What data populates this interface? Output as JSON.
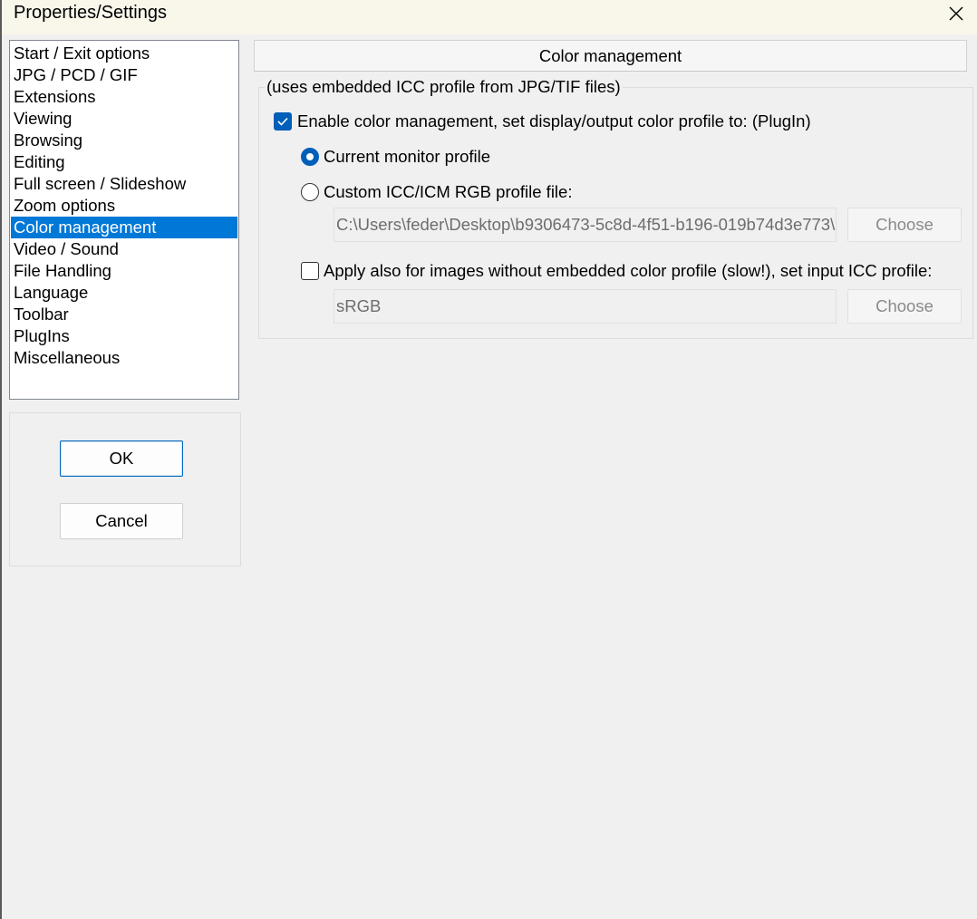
{
  "window": {
    "title": "Properties/Settings",
    "close_icon": "close-icon"
  },
  "sidebar": {
    "items": [
      {
        "label": "Start / Exit options",
        "selected": false
      },
      {
        "label": "JPG / PCD / GIF",
        "selected": false
      },
      {
        "label": "Extensions",
        "selected": false
      },
      {
        "label": "Viewing",
        "selected": false
      },
      {
        "label": "Browsing",
        "selected": false
      },
      {
        "label": "Editing",
        "selected": false
      },
      {
        "label": "Full screen / Slideshow",
        "selected": false
      },
      {
        "label": "Zoom options",
        "selected": false
      },
      {
        "label": "Color management",
        "selected": true
      },
      {
        "label": "Video / Sound",
        "selected": false
      },
      {
        "label": "File Handling",
        "selected": false
      },
      {
        "label": "Language",
        "selected": false
      },
      {
        "label": "Toolbar",
        "selected": false
      },
      {
        "label": "PlugIns",
        "selected": false
      },
      {
        "label": "Miscellaneous",
        "selected": false
      }
    ],
    "selection_color": "#0078d7"
  },
  "buttons": {
    "ok_label": "OK",
    "cancel_label": "Cancel"
  },
  "panel": {
    "header": "Color management",
    "group_legend": "(uses embedded ICC profile from JPG/TIF files)",
    "enable_cm": {
      "label": "Enable color management, set display/output color profile to: (PlugIn)",
      "checked": true
    },
    "current_monitor": {
      "label": "Current monitor profile",
      "selected": true
    },
    "custom_icc": {
      "label": "Custom ICC/ICM RGB profile file:",
      "selected": false,
      "path_value": "C:\\Users\\feder\\Desktop\\b9306473-5c8d-4f51-b196-019b74d3e773\\",
      "choose_label": "Choose"
    },
    "apply_also": {
      "label": "Apply also for images without embedded color profile (slow!), set input ICC profile:",
      "checked": false,
      "profile_value": "sRGB",
      "choose_label": "Choose"
    },
    "accent_color": "#005fb8"
  }
}
